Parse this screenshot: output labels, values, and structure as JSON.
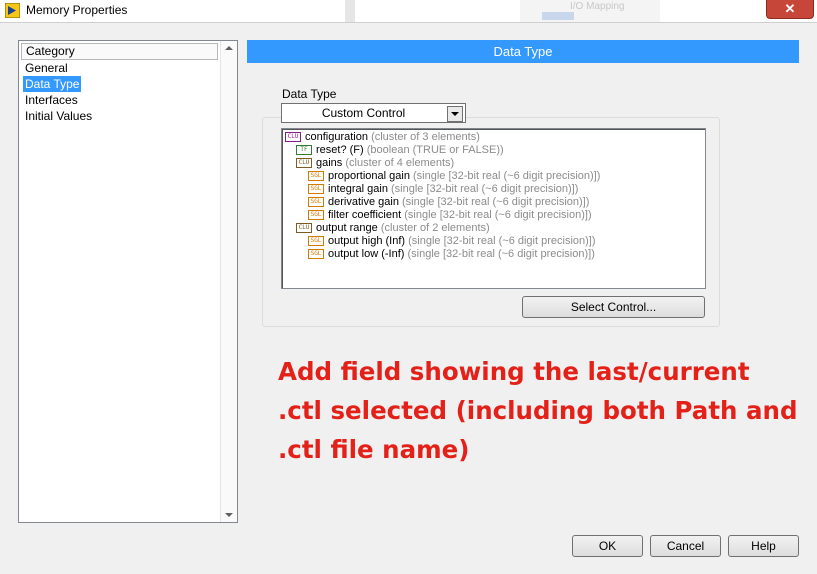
{
  "window": {
    "title": "Memory Properties",
    "close_label": "✕"
  },
  "background": {
    "ghost_text": "I/O Mapping"
  },
  "category": {
    "header": "Category",
    "items": [
      {
        "label": "General",
        "selected": false
      },
      {
        "label": "Data Type",
        "selected": true
      },
      {
        "label": "Interfaces",
        "selected": false
      },
      {
        "label": "Initial Values",
        "selected": false
      }
    ]
  },
  "section": {
    "title": "Data Type"
  },
  "data_type": {
    "label": "Data Type",
    "selected_value": "Custom Control",
    "tree": [
      {
        "icon": "cluster-icon",
        "name": "configuration",
        "desc": "(cluster of 3 elements)",
        "level": 0
      },
      {
        "icon": "boolean-icon",
        "name": "reset? (F)",
        "desc": "(boolean (TRUE or FALSE))",
        "level": 1
      },
      {
        "icon": "cluster-icon",
        "name": "gains",
        "desc": "(cluster of 4 elements)",
        "level": 1
      },
      {
        "icon": "single-icon",
        "name": "proportional gain",
        "desc": "(single [32-bit real (~6 digit precision)])",
        "level": 2
      },
      {
        "icon": "single-icon",
        "name": "integral gain",
        "desc": "(single [32-bit real (~6 digit precision)])",
        "level": 2
      },
      {
        "icon": "single-icon",
        "name": "derivative gain",
        "desc": "(single [32-bit real (~6 digit precision)])",
        "level": 2
      },
      {
        "icon": "single-icon",
        "name": "filter coefficient",
        "desc": "(single [32-bit real (~6 digit precision)])",
        "level": 2
      },
      {
        "icon": "cluster-icon",
        "name": "output range",
        "desc": "(cluster of 2 elements)",
        "level": 1
      },
      {
        "icon": "single-icon",
        "name": "output high (Inf)",
        "desc": "(single [32-bit real (~6 digit precision)])",
        "level": 2
      },
      {
        "icon": "single-icon",
        "name": "output low (-Inf)",
        "desc": "(single [32-bit real (~6 digit precision)])",
        "level": 2
      }
    ],
    "select_control_label": "Select Control..."
  },
  "annotation": {
    "lines": [
      "Add field showing the last/current",
      ".ctl selected (including both Path and",
      ".ctl file name)"
    ],
    "color": "#e32119"
  },
  "buttons": {
    "ok": "OK",
    "cancel": "Cancel",
    "help": "Help"
  },
  "colors": {
    "accent": "#3399ff",
    "close": "#c7463a"
  }
}
